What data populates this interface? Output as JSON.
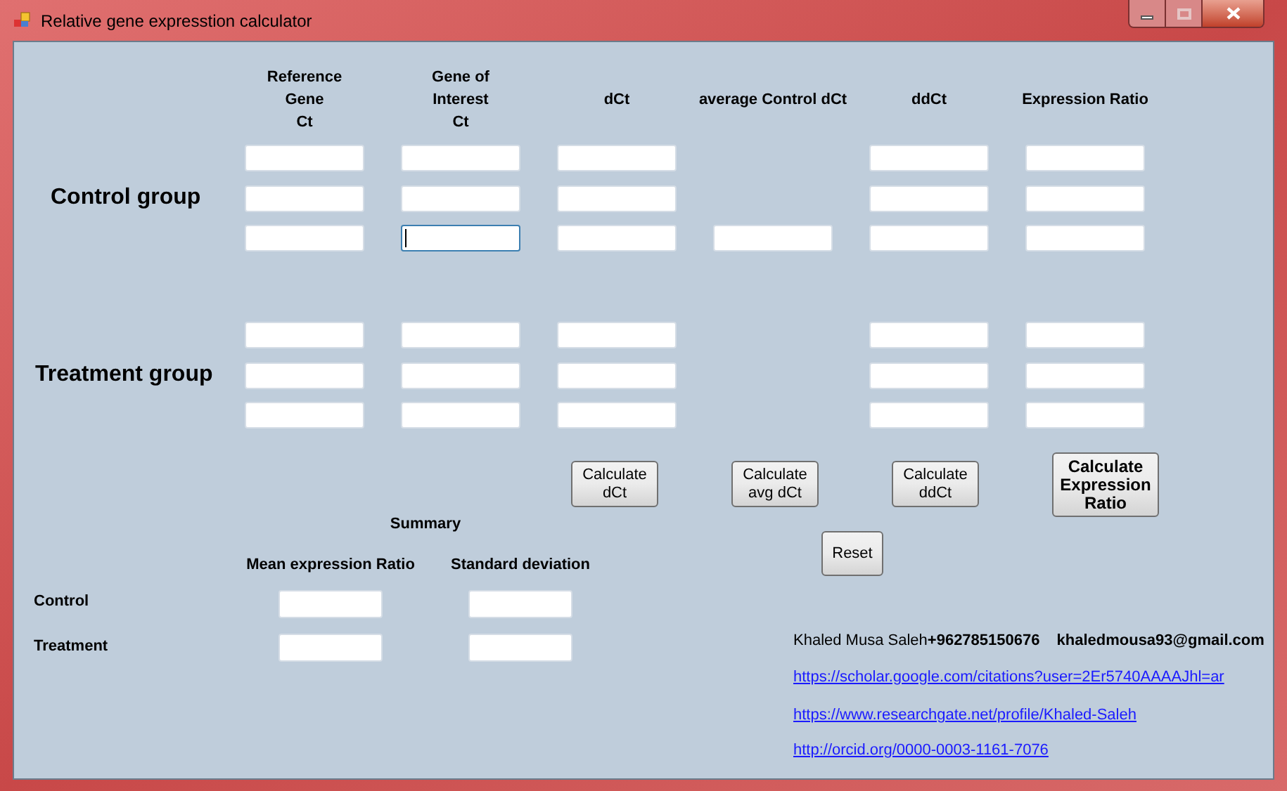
{
  "window": {
    "title": "Relative gene expresstion calculator"
  },
  "columns": [
    {
      "lines": [
        "Reference",
        "Gene",
        "Ct"
      ]
    },
    {
      "lines": [
        "Gene of",
        "Interest",
        "Ct"
      ]
    },
    {
      "lines": [
        "dCt"
      ]
    },
    {
      "lines": [
        "average Control dCt"
      ]
    },
    {
      "lines": [
        "ddCt"
      ]
    },
    {
      "lines": [
        "Expression Ratio"
      ]
    }
  ],
  "groups": [
    {
      "label": "Control group",
      "rows": [
        {
          "fields": [
            {
              "kind": "field",
              "focused": false
            },
            {
              "kind": "field",
              "focused": false
            },
            {
              "kind": "field",
              "focused": false
            },
            {
              "kind": "blank"
            },
            {
              "kind": "field",
              "focused": false
            },
            {
              "kind": "field",
              "focused": false
            }
          ]
        },
        {
          "fields": [
            {
              "kind": "field",
              "focused": false
            },
            {
              "kind": "field",
              "focused": false
            },
            {
              "kind": "field",
              "focused": false
            },
            {
              "kind": "blank"
            },
            {
              "kind": "field",
              "focused": false
            },
            {
              "kind": "field",
              "focused": false
            }
          ]
        },
        {
          "fields": [
            {
              "kind": "field",
              "focused": false
            },
            {
              "kind": "field",
              "focused": true
            },
            {
              "kind": "field",
              "focused": false
            },
            {
              "kind": "field",
              "focused": false
            },
            {
              "kind": "field",
              "focused": false
            },
            {
              "kind": "field",
              "focused": false
            }
          ]
        }
      ]
    },
    {
      "label": "Treatment group",
      "rows": [
        {
          "fields": [
            {
              "kind": "field",
              "focused": false
            },
            {
              "kind": "field",
              "focused": false
            },
            {
              "kind": "field",
              "focused": false
            },
            {
              "kind": "blank"
            },
            {
              "kind": "field",
              "focused": false
            },
            {
              "kind": "field",
              "focused": false
            }
          ]
        },
        {
          "fields": [
            {
              "kind": "field",
              "focused": false
            },
            {
              "kind": "field",
              "focused": false
            },
            {
              "kind": "field",
              "focused": false
            },
            {
              "kind": "blank"
            },
            {
              "kind": "field",
              "focused": false
            },
            {
              "kind": "field",
              "focused": false
            }
          ]
        },
        {
          "fields": [
            {
              "kind": "field",
              "focused": false
            },
            {
              "kind": "field",
              "focused": false
            },
            {
              "kind": "field",
              "focused": false
            },
            {
              "kind": "blank"
            },
            {
              "kind": "field",
              "focused": false
            },
            {
              "kind": "field",
              "focused": false
            }
          ]
        }
      ]
    }
  ],
  "buttons": [
    {
      "lines": [
        "Calculate",
        "dCt"
      ],
      "kind": "normal"
    },
    {
      "lines": [
        "Calculate",
        "avg dCt"
      ],
      "kind": "normal"
    },
    {
      "lines": [
        "Calculate",
        "ddCt"
      ],
      "kind": "normal"
    },
    {
      "lines": [
        "Calculate",
        "Expression",
        "Ratio"
      ],
      "kind": "bold"
    }
  ],
  "reset_button": "Reset",
  "summary": {
    "title": "Summary",
    "headers": [
      "Mean expression Ratio",
      "Standard deviation"
    ],
    "rows": [
      {
        "label": "Control"
      },
      {
        "label": "Treatment"
      }
    ]
  },
  "contact": {
    "name": "Khaled Musa Saleh",
    "phone": "+962785150676",
    "email": "khaledmousa93@gmail.com",
    "links": [
      "https://scholar.google.com/citations?user=2Er5740AAAAJhl=ar",
      "https://www.researchgate.net/profile/Khaled-Saleh",
      "http://orcid.org/0000-0003-1161-7076"
    ]
  }
}
